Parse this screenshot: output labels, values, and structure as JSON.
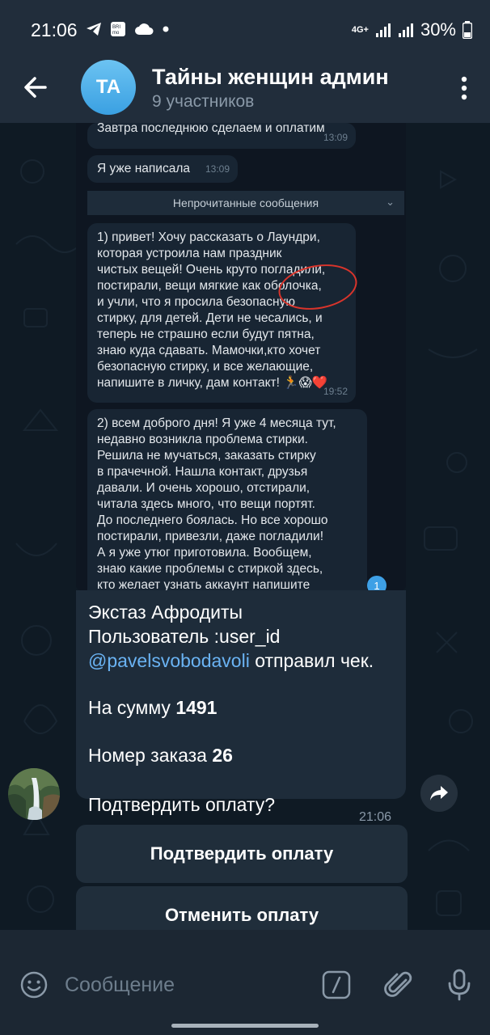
{
  "status_bar": {
    "time": "21:06",
    "network": "4G+",
    "battery": "30%",
    "left_icons": [
      "telegram-icon",
      "brimo-icon",
      "cloud-icon",
      "dot-icon"
    ]
  },
  "header": {
    "avatar_initials": "TA",
    "title": "Тайны женщин админ",
    "subtitle": "9 участников"
  },
  "embedded_screenshot": {
    "msg_top": {
      "text": "Завтра последнюю сделаем и оплатим",
      "time": "13:09"
    },
    "msg_wrote": {
      "text": "Я уже написала",
      "time": "13:09"
    },
    "unread_label": "Непрочитанные сообщения",
    "msg1": {
      "lines": [
        "1) привет! Хочу рассказать о Лаундри,",
        "которая устроила нам праздник",
        "чистых вещей! Очень круто погладили,",
        "постирали, вещи мягкие как оболочка,",
        "и учли, что я просила безопасную",
        "стирку, для детей. Дети не чесались, и",
        "теперь не страшно если будут пятна,",
        "знаю куда сдавать. Мамочки,кто хочет",
        "безопасную стирку, и все желающие,",
        "напишите в личку, дам контакт! 🏃😱❤️"
      ],
      "time": "19:52"
    },
    "msg2": {
      "lines": [
        "2) всем доброго дня! Я уже 4 месяца тут,",
        "недавно возникла проблема стирки.",
        "Решила не мучаться, заказать стирку",
        "в прачечной. Нашла контакт, друзья",
        "давали. И очень хорошо, отстирали,",
        "читала здесь много, что вещи портят.",
        "До последнего боялась. Но все хорошо",
        "постирали, привезли, даже погладили!",
        "А я уже утюг приготовила. Вообщем,",
        "знаю какие проблемы с стиркой здесь,",
        "кто желает узнать аккаунт напишите"
      ]
    },
    "badge": "1"
  },
  "bubble": {
    "sender": "Экстаз Афродиты",
    "user_line": "Пользователь :user_id",
    "mention": "@pavelsvobodavoli",
    "action": "отправил чек.",
    "sum_label": "На сумму",
    "sum_value": "1491",
    "order_label": "Номер заказа",
    "order_value": "26",
    "question": "Подтвердить оплату?",
    "time": "21:06"
  },
  "buttons": {
    "confirm": "Подтвердить оплату",
    "cancel": "Отменить оплату"
  },
  "input": {
    "placeholder": "Сообщение"
  }
}
